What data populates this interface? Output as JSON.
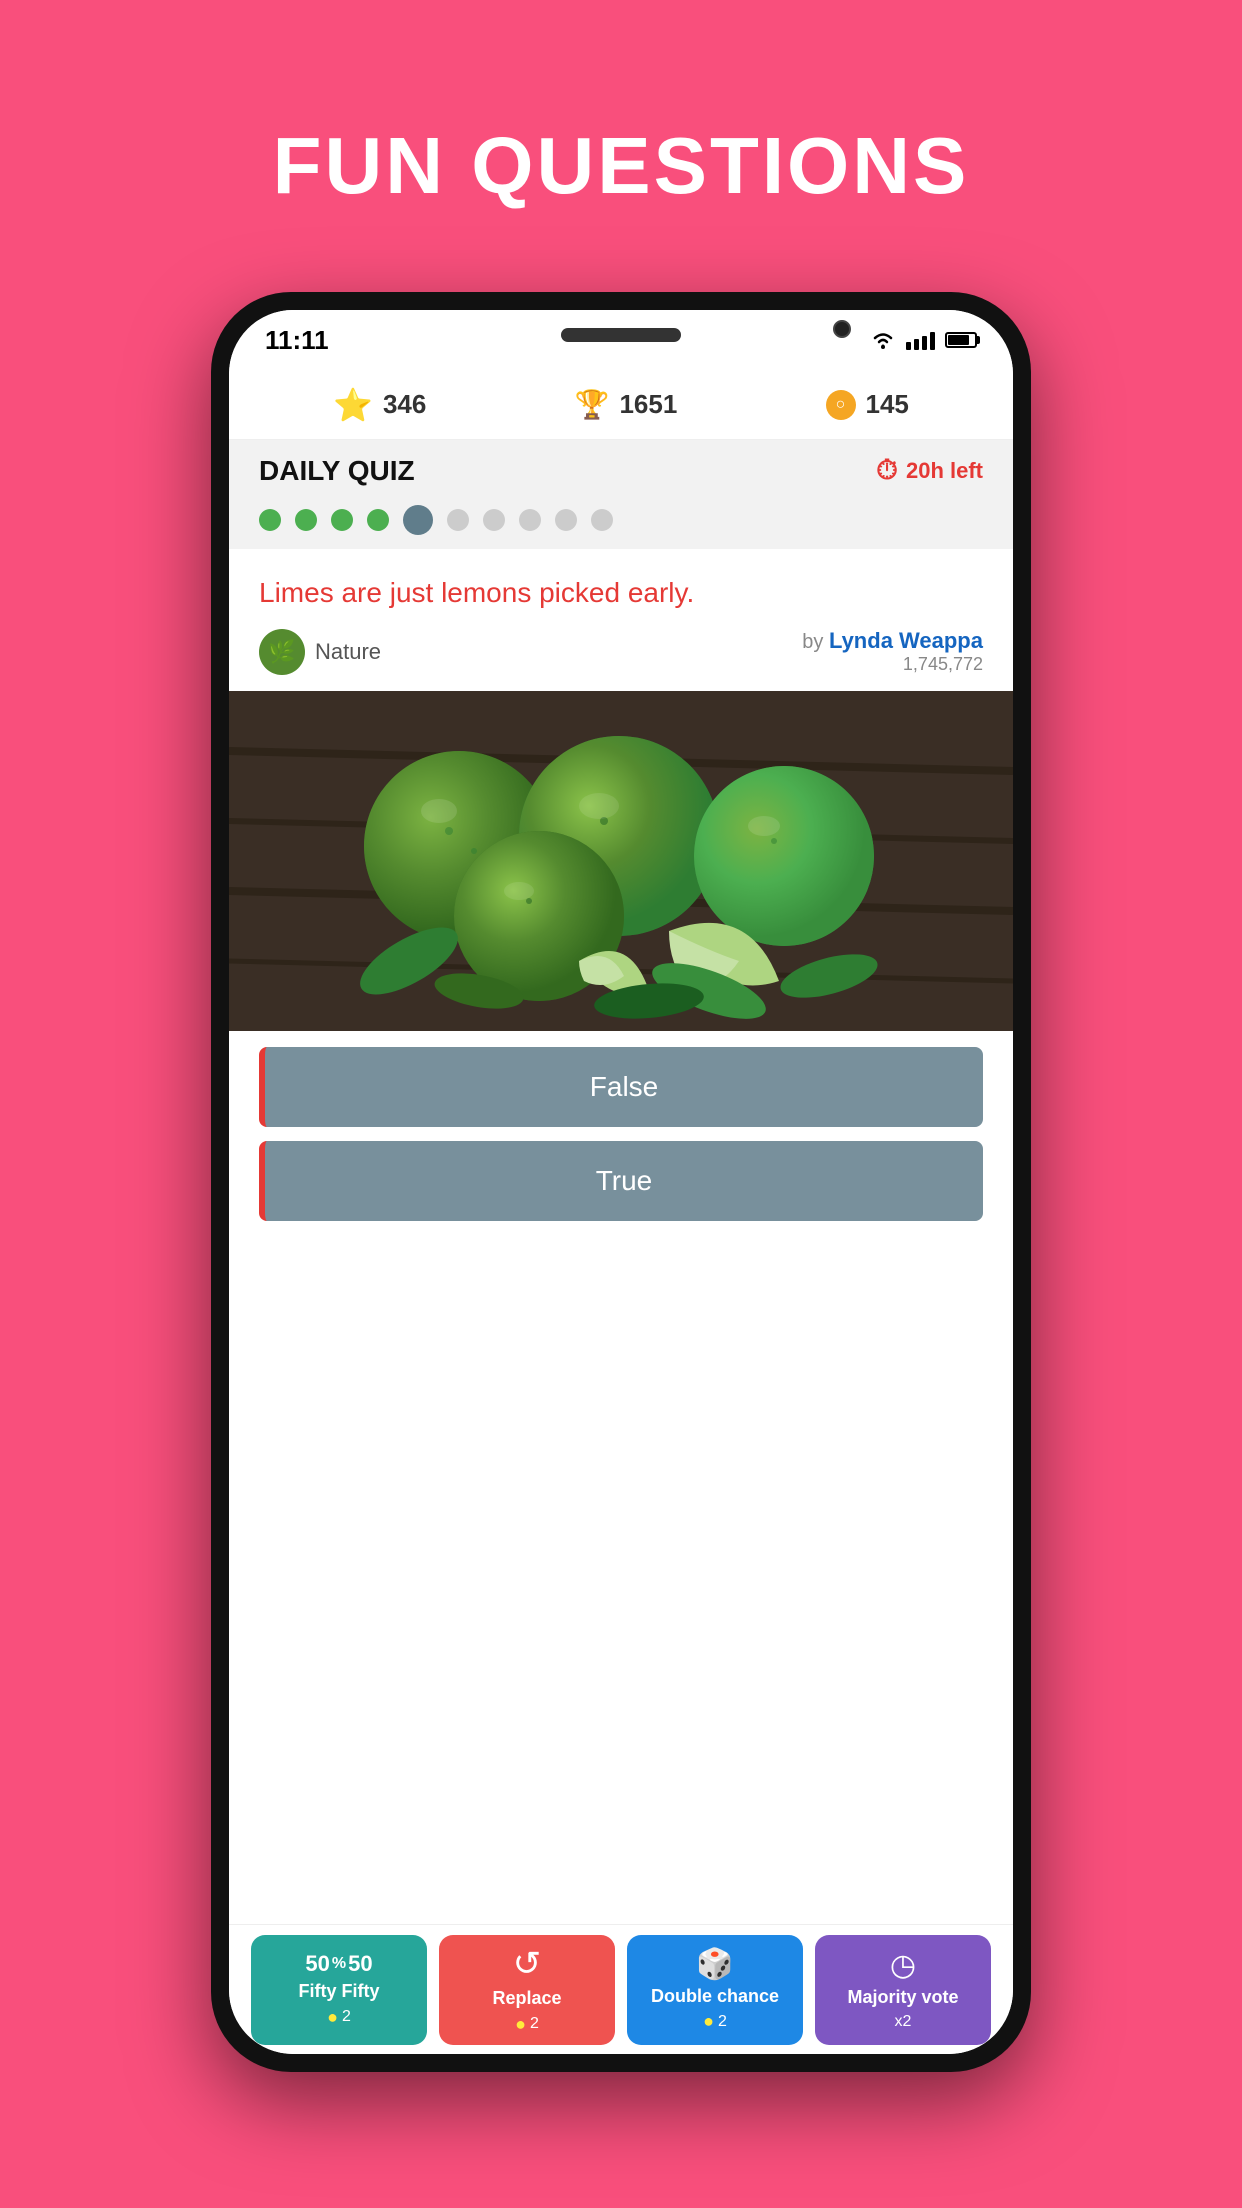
{
  "page": {
    "title": "FUN QUESTIONS",
    "background": "#f94f7c"
  },
  "status_bar": {
    "time": "11:11"
  },
  "scores": {
    "stars": "346",
    "trophy": "1651",
    "coins": "145"
  },
  "quiz": {
    "title": "DAILY QUIZ",
    "time_left": "20h left",
    "progress_dots": [
      "completed",
      "completed",
      "completed",
      "completed",
      "current",
      "pending",
      "pending",
      "pending",
      "pending",
      "pending"
    ]
  },
  "question": {
    "text": "Limes are just lemons picked early.",
    "category": "Nature",
    "author_by": "by",
    "author_name": "Lynda Weappa",
    "author_score": "1,745,772"
  },
  "answers": [
    {
      "label": "False"
    },
    {
      "label": "True"
    }
  ],
  "powerups": [
    {
      "label": "Fifty\nFifty",
      "icon": "50%",
      "cost": "2",
      "style": "fifty"
    },
    {
      "label": "Replace",
      "icon": "↺",
      "cost": "2",
      "style": "replace"
    },
    {
      "label": "Double\nchance",
      "icon": "🎲",
      "cost": "2",
      "style": "double"
    },
    {
      "label": "Majority\nvote",
      "icon": "◷",
      "cost": "x2",
      "style": "majority"
    }
  ]
}
